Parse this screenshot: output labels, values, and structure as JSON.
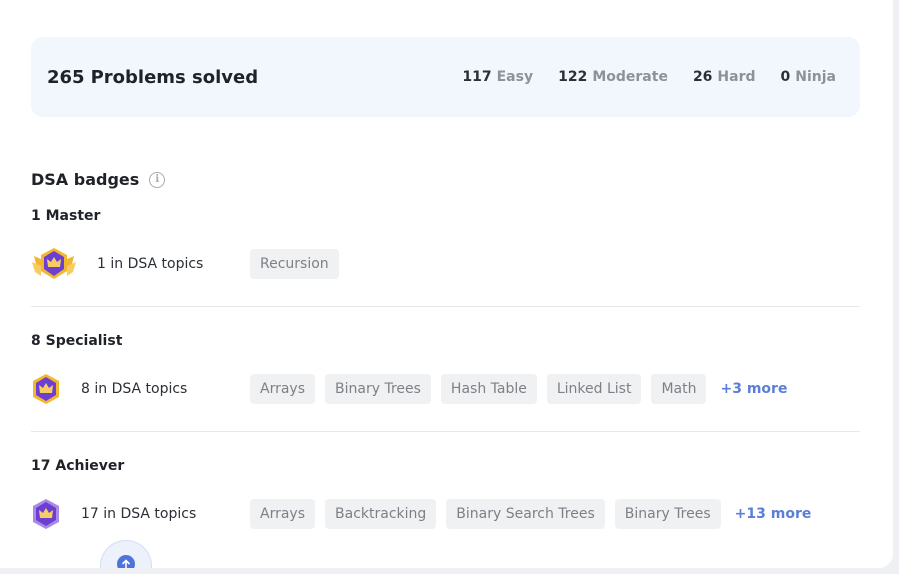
{
  "solved": {
    "count": "265",
    "label": "Problems solved",
    "stats": [
      {
        "value": "117",
        "label": "Easy"
      },
      {
        "value": "122",
        "label": "Moderate"
      },
      {
        "value": "26",
        "label": "Hard"
      },
      {
        "value": "0",
        "label": "Ninja"
      }
    ]
  },
  "badges": {
    "title": "DSA badges",
    "info_glyph": "i",
    "groups": [
      {
        "title": "1 Master",
        "topics_text": "1 in DSA topics",
        "chips": [
          "Recursion"
        ],
        "more": ""
      },
      {
        "title": "8 Specialist",
        "topics_text": "8 in DSA topics",
        "chips": [
          "Arrays",
          "Binary Trees",
          "Hash Table",
          "Linked List",
          "Math"
        ],
        "more": "+3 more"
      },
      {
        "title": "17 Achiever",
        "topics_text": "17 in DSA topics",
        "chips": [
          "Arrays",
          "Backtracking",
          "Binary Search Trees",
          "Binary Trees"
        ],
        "more": "+13 more"
      }
    ]
  },
  "colors": {
    "accent": "#5b7fd6",
    "badge_purple": "#6c3fd1",
    "badge_gold": "#f2b631",
    "card_bg": "#f2f7fe"
  }
}
